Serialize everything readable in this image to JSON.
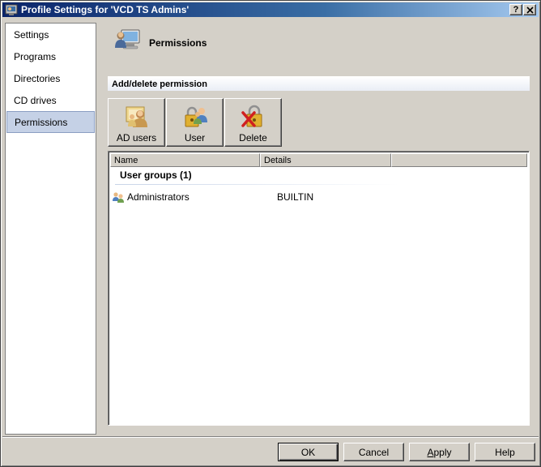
{
  "window": {
    "title": "Profile Settings for 'VCD TS Admins'",
    "help_button": "?",
    "close_button": "X"
  },
  "sidebar": {
    "items": [
      {
        "label": "Settings"
      },
      {
        "label": "Programs"
      },
      {
        "label": "Directories"
      },
      {
        "label": "CD drives"
      },
      {
        "label": "Permissions",
        "selected": true
      }
    ]
  },
  "page": {
    "title": "Permissions",
    "section": "Add/delete permission"
  },
  "toolbar": {
    "ad_users": "AD users",
    "user": "User",
    "delete": "Delete"
  },
  "list": {
    "columns": [
      "Name",
      "Details"
    ],
    "group": "User groups (1)",
    "rows": [
      {
        "name": "Administrators",
        "details": "BUILTIN"
      }
    ]
  },
  "buttons": {
    "ok": "OK",
    "cancel": "Cancel",
    "apply_first": "A",
    "apply_rest": "pply",
    "help": "Help"
  },
  "icons": {
    "app": "profile-settings-icon",
    "header": "users-computer-icon",
    "ad_users": "ad-users-icon",
    "user": "user-lock-icon",
    "delete": "delete-lock-icon",
    "row": "user-group-icon"
  }
}
